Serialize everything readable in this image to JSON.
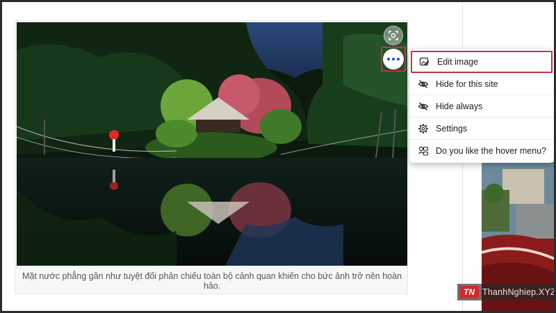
{
  "caption": "Mặt nước phẳng gần như tuyệt đối phản chiếu toàn bộ cảnh quan khiến cho bức ảnh trở nên hoàn hảo.",
  "hover_buttons": {
    "visual_search_icon": "lens-icon",
    "more_icon": "more-dots-icon"
  },
  "menu": {
    "items": [
      {
        "label": "Edit image",
        "icon": "edit-image-icon"
      },
      {
        "label": "Hide for this site",
        "icon": "eye-slash-icon"
      },
      {
        "label": "Hide always",
        "icon": "eye-slash-icon"
      },
      {
        "label": "Settings",
        "icon": "gear-icon"
      },
      {
        "label": "Do you like the hover menu?",
        "icon": "feedback-icon"
      }
    ]
  },
  "watermark": {
    "logo": "TN",
    "text": "ThanhNghiep.XYZ"
  },
  "colors": {
    "highlight": "#c4314b",
    "dots": "#1a55c4"
  }
}
